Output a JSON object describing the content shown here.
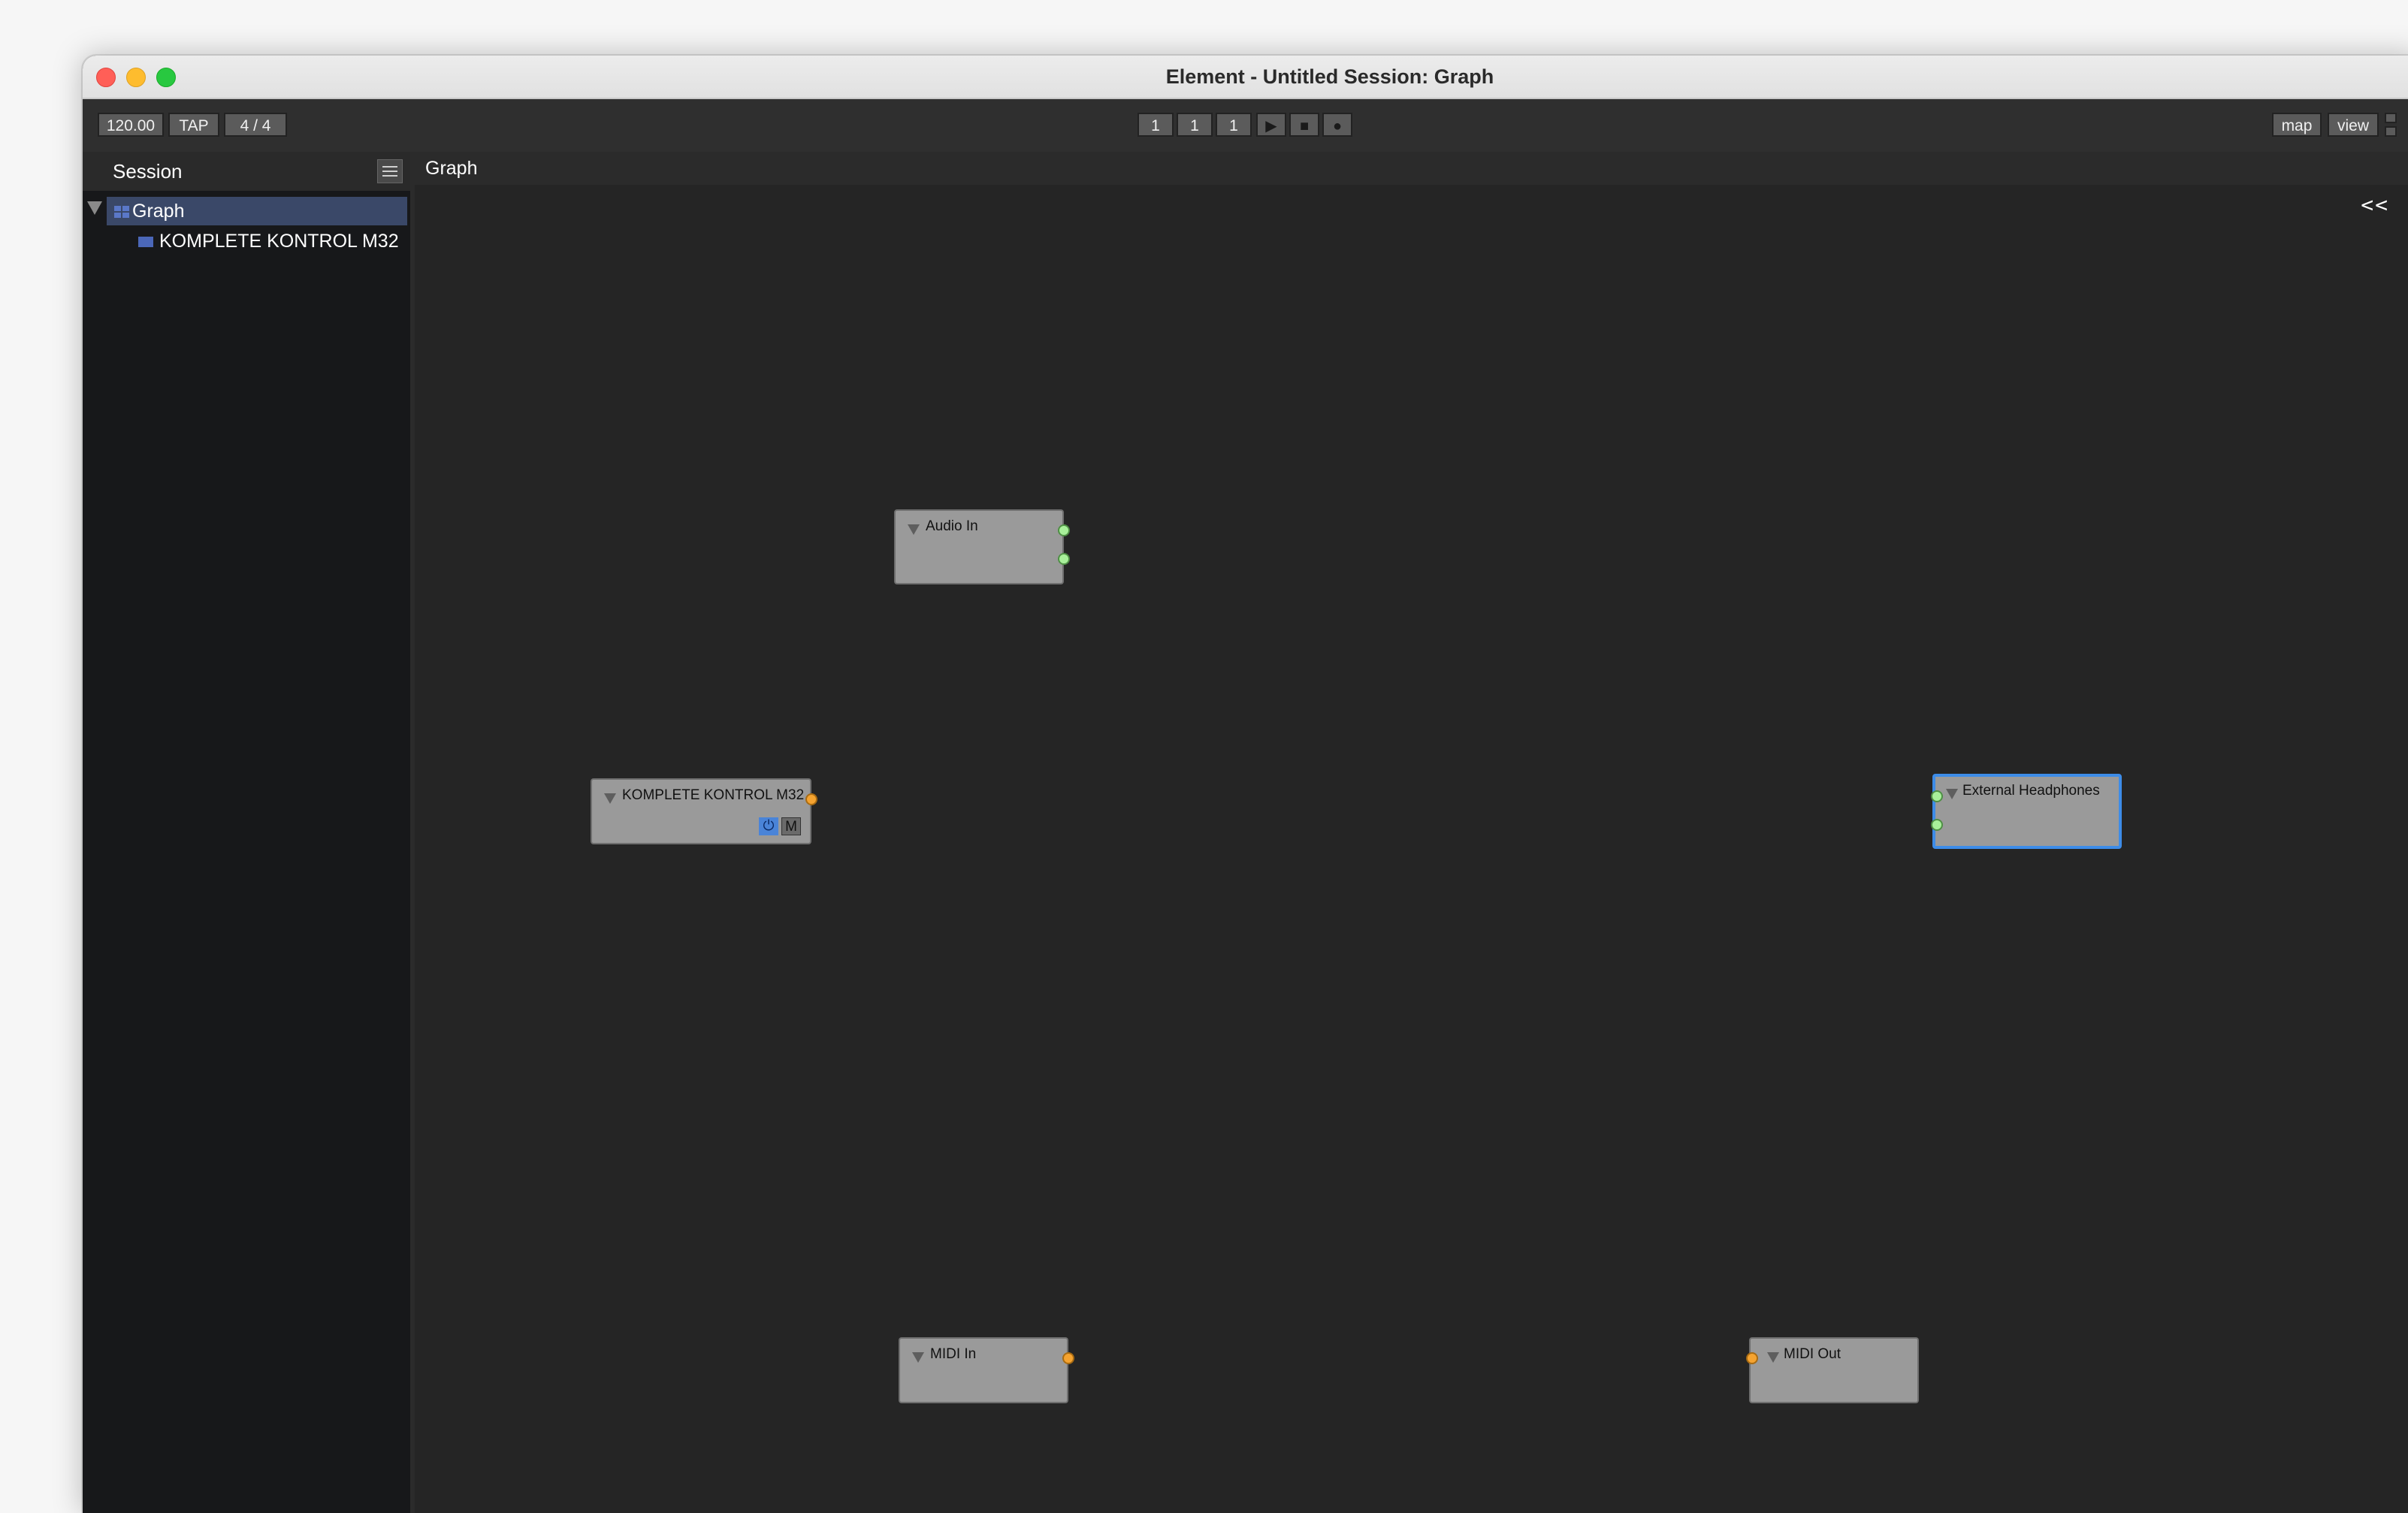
{
  "window": {
    "title": "Element - Untitled Session: Graph"
  },
  "toolbar": {
    "tempo": "120.00",
    "tap": "TAP",
    "meter": "4 / 4",
    "bar": "1",
    "beat": "1",
    "tick": "1",
    "map_label": "map",
    "view_label": "view"
  },
  "sidebar": {
    "title": "Session",
    "tree": [
      {
        "label": "Graph",
        "selected": true,
        "icon": "graph-icon"
      },
      {
        "label": "KOMPLETE KONTROL M32",
        "selected": false,
        "icon": "node-icon"
      }
    ]
  },
  "graph": {
    "title": "Graph",
    "collapse_label": "<<",
    "nodes": [
      {
        "name": "Audio In",
        "ports": [
          "audio-out",
          "audio-out"
        ]
      },
      {
        "name": "KOMPLETE KONTROL M32",
        "ports": [
          "midi-out"
        ],
        "buttons": {
          "power": "⏻",
          "mute": "M"
        }
      },
      {
        "name": "External Headphones",
        "selected": true,
        "ports": [
          "audio-in",
          "audio-in"
        ]
      },
      {
        "name": "MIDI In",
        "ports": [
          "midi-out"
        ]
      },
      {
        "name": "MIDI Out",
        "ports": [
          "midi-in"
        ]
      }
    ]
  },
  "colors": {
    "audio_port": "#a8f09a",
    "midi_port": "#f5a330",
    "selection": "#3d8ce8",
    "tree_selection": "#3a4868"
  }
}
